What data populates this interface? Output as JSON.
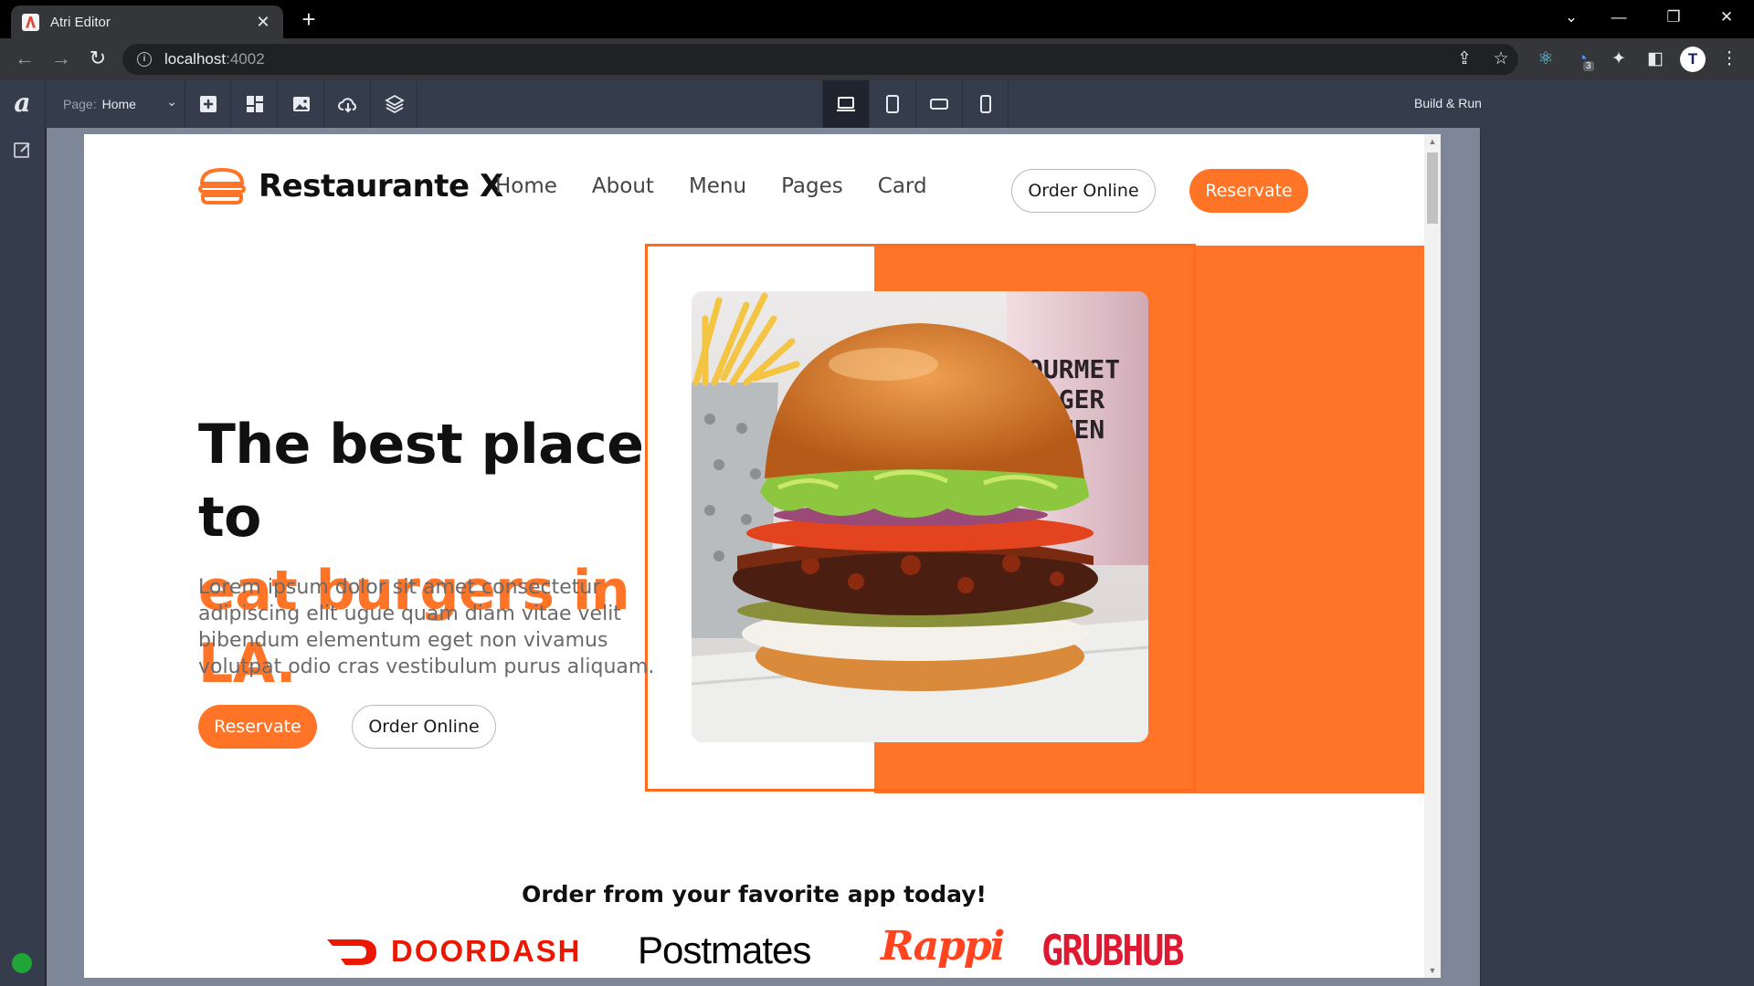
{
  "browser": {
    "tab_title": "Atri Editor",
    "url_host": "localhost",
    "url_port": ":4002",
    "profile_initial": "T",
    "extension_badge": "3"
  },
  "editor": {
    "logo": "a",
    "page_label": "Page:",
    "page_value": "Home",
    "build_run": "Build & Run"
  },
  "site": {
    "brand": "Restaurante X",
    "nav": [
      "Home",
      "About",
      "Menu",
      "Pages",
      "Card"
    ],
    "order_online": "Order Online",
    "reservate": "Reservate",
    "hero_line1": "The best place to",
    "hero_line2": "eat burgers in LA.",
    "hero_text": "Lorem ipsum dolor sit amet consectetur adipiscing elit ugue quam diam vitae velit bibendum elementum eget non vivamus volutpat odio cras vestibulum purus aliquam.",
    "photo_cup_text": "OURMET URGER TCHEN",
    "apps_title": "Order from your favorite app today!",
    "apps": [
      "DOORDASH",
      "Postmates",
      "Rappi",
      "GRUBHUB"
    ]
  },
  "colors": {
    "accent": "#ff7427",
    "editor_bg": "#353d4c",
    "canvas_bg": "#7e8797"
  }
}
